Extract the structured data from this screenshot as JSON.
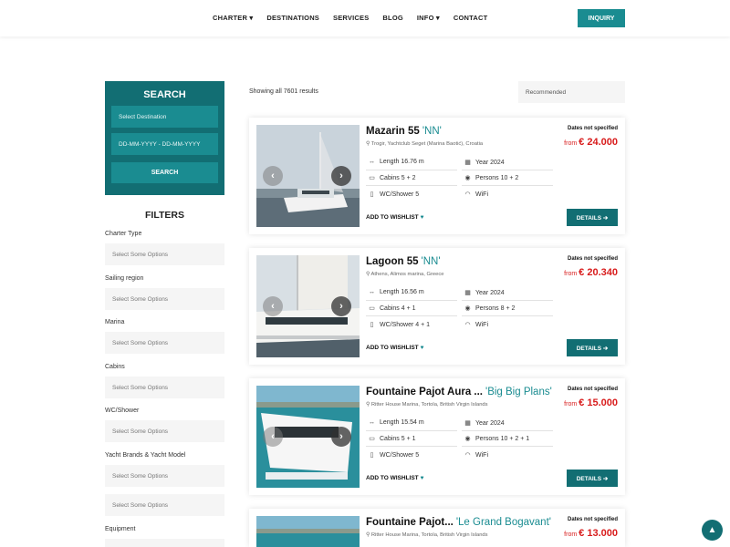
{
  "nav": {
    "items": [
      "CHARTER ▾",
      "DESTINATIONS",
      "SERVICES",
      "BLOG",
      "INFO ▾",
      "CONTACT"
    ],
    "inquiry_label": "INQUIRY"
  },
  "search": {
    "title": "SEARCH",
    "destination_placeholder": "Select Destination",
    "date_placeholder": "DD-MM-YYYY - DD-MM-YYYY",
    "button_label": "SEARCH"
  },
  "filters": {
    "title": "FILTERS",
    "groups": [
      {
        "label": "Charter Type",
        "placeholder": "Select Some Options"
      },
      {
        "label": "Sailing region",
        "placeholder": "Select Some Options"
      },
      {
        "label": "Marina",
        "placeholder": "Select Some Options"
      },
      {
        "label": "Cabins",
        "placeholder": "Select Some Options"
      },
      {
        "label": "WC/Shower",
        "placeholder": "Select Some Options"
      },
      {
        "label": "Yacht Brands & Yacht Model",
        "placeholder": "Select Some Options"
      },
      {
        "label": "",
        "placeholder": "Select Some Options"
      },
      {
        "label": "Equipment",
        "placeholder": ""
      }
    ]
  },
  "results": {
    "count_text": "Showing all 7601 results",
    "sort_value": "Recommended"
  },
  "cards": [
    {
      "name": "Mazarin 55",
      "nick": "'NN'",
      "location": "Trogir, Yachtclub Seget (Marina Baotić), Croatia",
      "length": "Length 16.76 m",
      "year": "Year 2024",
      "cabins": "Cabins 5 + 2",
      "persons": "Persons 10 + 2",
      "wc": "WC/Shower 5",
      "wifi": "WiFi",
      "dates": "Dates not specified",
      "from": "from",
      "price": "€ 24.000"
    },
    {
      "name": "Lagoon 55",
      "nick": "'NN'",
      "location": "Athens, Alimos marina, Greece",
      "length": "Length 16.56 m",
      "year": "Year 2024",
      "cabins": "Cabins 4 + 1",
      "persons": "Persons 8 + 2",
      "wc": "WC/Shower 4 + 1",
      "wifi": "WiFi",
      "dates": "Dates not specified",
      "from": "from",
      "price": "€ 20.340"
    },
    {
      "name": "Fountaine Pajot Aura ...",
      "nick": "'Big Big Plans'",
      "location": "Ritter House Marina, Tortola, British Virgin Islands",
      "length": "Length 15.54 m",
      "year": "Year 2024",
      "cabins": "Cabins 5 + 1",
      "persons": "Persons 10 + 2 + 1",
      "wc": "WC/Shower 5",
      "wifi": "WiFi",
      "dates": "Dates not specified",
      "from": "from",
      "price": "€ 15.000"
    },
    {
      "name": "Fountaine Pajot...",
      "nick": "'Le Grand Bogavant'",
      "location": "Ritter House Marina, Tortola, British Virgin Islands",
      "dates": "Dates not specified",
      "from": "from",
      "price": "€ 13.000"
    }
  ],
  "card_actions": {
    "wishlist_label": "ADD TO WISHLIST",
    "details_label": "DETAILS ➔"
  },
  "icons": {
    "heart": "heart-icon",
    "scroll_top": "arrow-up-icon"
  },
  "colors": {
    "accent": "#126e73",
    "accent_light": "#1a8c91",
    "price": "#d81b1b"
  }
}
